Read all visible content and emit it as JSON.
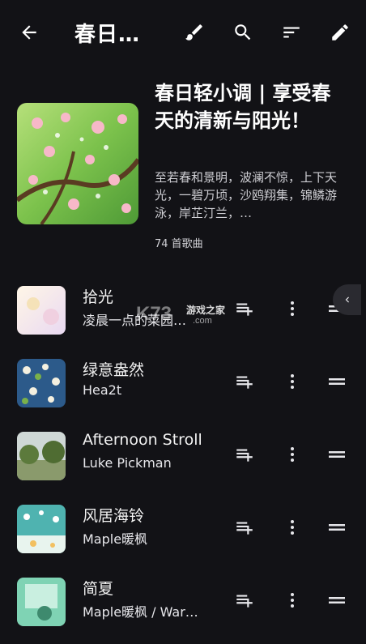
{
  "topbar": {
    "title": "春日…",
    "icons": [
      "back-arrow-icon",
      "brush-icon",
      "search-icon",
      "sort-icon",
      "edit-pencil-icon"
    ]
  },
  "playlist": {
    "title": "春日轻小调 | 享受春天的清新与阳光！",
    "description": "至若春和景明，波澜不惊，上下天光，一碧万顷，沙鸥翔集，锦鳞游泳，岸芷汀兰，…",
    "count": "74 首歌曲"
  },
  "songs": [
    {
      "title": "拾光",
      "artist": "凌晨一点的菜园…"
    },
    {
      "title": "绿意盎然",
      "artist": "Hea2t"
    },
    {
      "title": "Afternoon Stroll",
      "artist": "Luke Pickman"
    },
    {
      "title": "风居海铃",
      "artist": "Maple暖枫"
    },
    {
      "title": "简夏",
      "artist": "Maple暖枫 / War…"
    }
  ],
  "watermark": {
    "logo": "K73",
    "text": "游戏之家",
    "domain": ".com"
  }
}
